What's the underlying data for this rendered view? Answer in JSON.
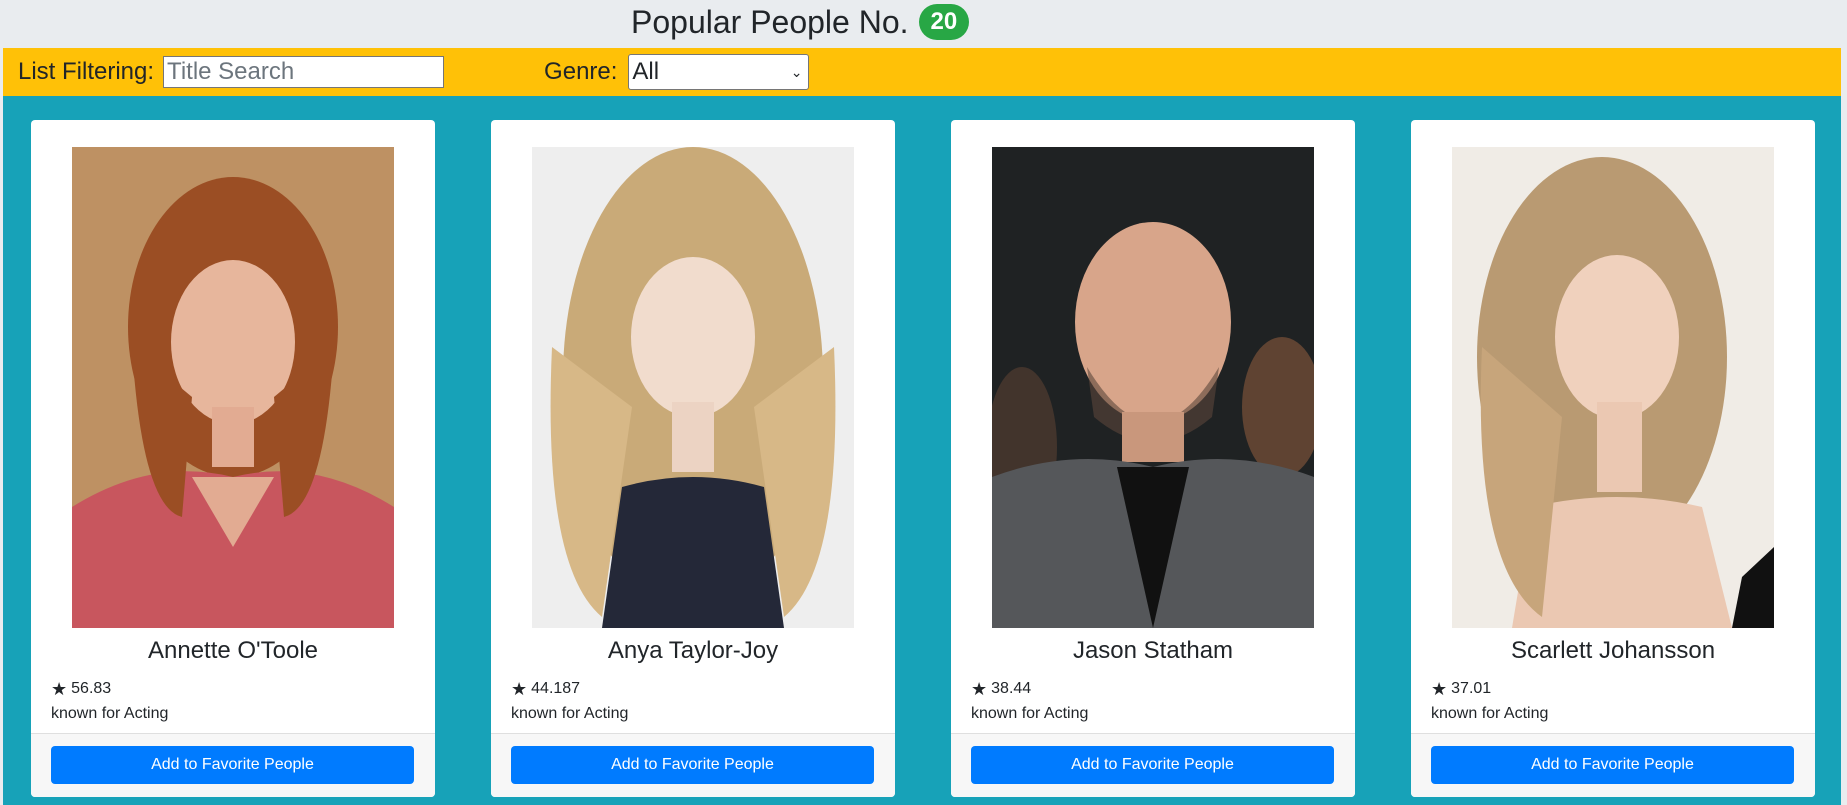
{
  "header": {
    "title": "Popular People No.",
    "count": "20"
  },
  "filters": {
    "list_label": "List Filtering:",
    "search_placeholder": "Title Search",
    "genre_label": "Genre:",
    "genre_selected": "All"
  },
  "people": [
    {
      "name": "Annette O'Toole",
      "rating": "56.83",
      "known_for": "known for Acting",
      "button": "Add to Favorite People"
    },
    {
      "name": "Anya Taylor-Joy",
      "rating": "44.187",
      "known_for": "known for Acting",
      "button": "Add to Favorite People"
    },
    {
      "name": "Jason Statham",
      "rating": "38.44",
      "known_for": "known for Acting",
      "button": "Add to Favorite People"
    },
    {
      "name": "Scarlett Johansson",
      "rating": "37.01",
      "known_for": "known for Acting",
      "button": "Add to Favorite People"
    }
  ],
  "colors": {
    "filter_bar": "#ffc107",
    "content_bg": "#17a2b8",
    "badge": "#28a745",
    "button": "#007bff"
  },
  "icons": {
    "rating": "star-icon",
    "dropdown": "chevron-down-icon"
  }
}
